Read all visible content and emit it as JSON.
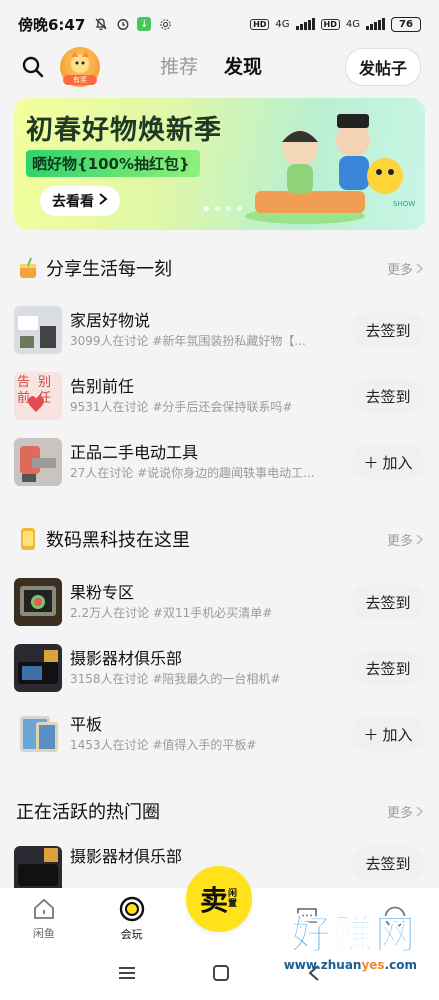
{
  "status_bar": {
    "time": "傍晚6:47",
    "network_1": "4G",
    "network_2": "4G",
    "battery": "76"
  },
  "top_nav": {
    "avatar_badge": "有奖",
    "tabs": [
      {
        "label": "推荐",
        "active": false
      },
      {
        "label": "发现",
        "active": true
      }
    ],
    "post_button": "发帖子"
  },
  "banner": {
    "title": "初春好物焕新季",
    "subtitle": "晒好物{100%抽红包}",
    "button": "去看看",
    "art_label": "SHOW",
    "dots": 4,
    "active_dot": 0
  },
  "sections": [
    {
      "title": "分享生活每一刻",
      "more": "更多",
      "items": [
        {
          "title": "家居好物说",
          "desc": "3099人在讨论 #新年氛围装扮私藏好物【...",
          "button": "去签到",
          "thumb_text": ""
        },
        {
          "title": "告别前任",
          "desc": "9531人在讨论 #分手后还会保持联系吗#",
          "button": "去签到",
          "thumb_text": "告别前任"
        },
        {
          "title": "正品二手电动工具",
          "desc": "27人在讨论 #说说你身边的趣闻轶事电动工...",
          "button": "加入",
          "thumb_text": ""
        }
      ]
    },
    {
      "title": "数码黑科技在这里",
      "more": "更多",
      "items": [
        {
          "title": "果粉专区",
          "desc": "2.2万人在讨论 #双11手机必买清单#",
          "button": "去签到",
          "thumb_text": ""
        },
        {
          "title": "摄影器材俱乐部",
          "desc": "3158人在讨论 #陪我最久的一台相机#",
          "button": "去签到",
          "thumb_text": ""
        },
        {
          "title": "平板",
          "desc": "1453人在讨论 #值得入手的平板#",
          "button": "加入",
          "thumb_text": ""
        }
      ]
    },
    {
      "title": "正在活跃的热门圈",
      "more": "更多",
      "items": [
        {
          "title": "摄影器材俱乐部",
          "desc": "",
          "button": "去签到",
          "thumb_text": ""
        }
      ]
    }
  ],
  "bottom_nav": {
    "items": [
      {
        "label": "闲鱼",
        "icon": "home-icon"
      },
      {
        "label": "会玩",
        "icon": "circle-target-icon",
        "active": true
      },
      {
        "label": "",
        "icon": "chat-icon"
      },
      {
        "label": "",
        "icon": "smile-icon"
      }
    ],
    "center": {
      "big": "卖",
      "small": "闲置"
    }
  },
  "watermark": {
    "big": "好赚网",
    "small_pre": "www.zhuan",
    "small_hl": "yes",
    "small_post": ".com"
  },
  "colors": {
    "accent_yellow": "#ffe21a",
    "bg": "#f4f4f4",
    "banner_green": "#2fd46d"
  }
}
